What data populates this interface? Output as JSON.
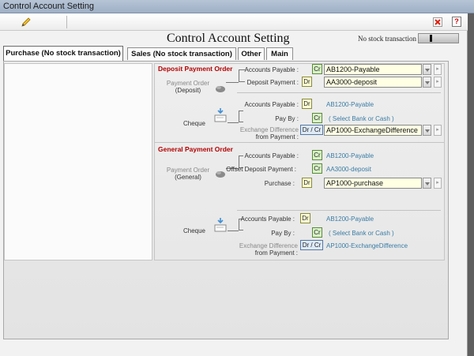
{
  "window": {
    "title": "Control Account Setting"
  },
  "toolbar": {
    "edit_icon": "pencil-icon",
    "close_icon": "close-icon",
    "help_label": "?"
  },
  "header": {
    "title": "Control Account Setting",
    "no_stock_label": "No stock transaction"
  },
  "tabs": [
    {
      "label": "Purchase (No stock transaction)",
      "active": true
    },
    {
      "label": "Sales (No stock transaction)",
      "active": false
    },
    {
      "label": "Other",
      "active": false
    },
    {
      "label": "Main",
      "active": false
    }
  ],
  "deposit": {
    "section_title": "Deposit Payment Order",
    "payment_order_label_1": "Payment Order",
    "payment_order_label_2": "(Deposit)",
    "accounts_payable_label": "Accounts Payable :",
    "accounts_payable_badge": "Cr",
    "accounts_payable_value": "AB1200-Payable",
    "deposit_payment_label": "Deposit Payment :",
    "deposit_payment_badge": "Dr",
    "deposit_payment_value": "AA3000-deposit",
    "cheque_label": "Cheque",
    "cheque_ap_label": "Accounts Payable :",
    "cheque_ap_badge": "Dr",
    "cheque_ap_value": "AB1200-Payable",
    "pay_by_label": "Pay By :",
    "pay_by_badge": "Cr",
    "pay_by_value": "( Select Bank or Cash )",
    "exch_label_1": "Exchange Difference",
    "exch_label_2": "from Payment :",
    "exch_badge": "Dr / Cr",
    "exch_value": "AP1000-ExchangeDifference"
  },
  "general": {
    "section_title": "General Payment Order",
    "payment_order_label_1": "Payment Order",
    "payment_order_label_2": "(General)",
    "accounts_payable_label": "Accounts Payable :",
    "accounts_payable_badge": "Cr",
    "accounts_payable_value": "AB1200-Payable",
    "offset_label": "Offset Deposit Payment :",
    "offset_badge": "Cr",
    "offset_value": "AA3000-deposit",
    "purchase_label": "Purchase :",
    "purchase_badge": "Dr",
    "purchase_value": "AP1000-purchase",
    "cheque_label": "Cheque",
    "cheque_ap_label": "Accounts Payable :",
    "cheque_ap_badge": "Dr",
    "cheque_ap_value": "AB1200-Payable",
    "pay_by_label": "Pay By :",
    "pay_by_badge": "Cr",
    "pay_by_value": "( Select Bank or Cash )",
    "exch_label_1": "Exchange Difference",
    "exch_label_2": "from Payment :",
    "exch_badge": "Dr / Cr",
    "exch_value": "AP1000-ExchangeDifference"
  },
  "colors": {
    "section_title": "#b30000",
    "badge_cr": "#d9f3c8",
    "badge_dr": "#ffffd6",
    "badge_drcr": "#dde9f6",
    "value_blue": "#3a7ca5"
  }
}
